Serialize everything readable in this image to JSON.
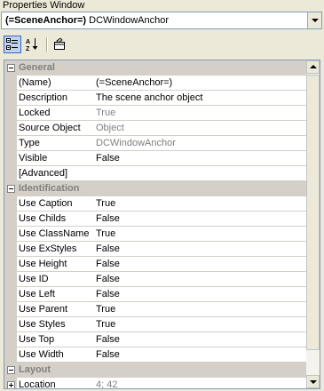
{
  "window": {
    "title": "Properties Window"
  },
  "object_selector": {
    "object_name": "(=SceneAnchor=)",
    "object_type": "DCWindowAnchor"
  },
  "toolbar": {
    "buttons": [
      {
        "icon": "categorized-icon",
        "pressed": true
      },
      {
        "icon": "alphabetical-sort-icon",
        "pressed": false
      },
      {
        "icon": "property-pages-icon",
        "pressed": false
      }
    ]
  },
  "grid": {
    "categories": {
      "general": {
        "label": "General"
      },
      "identification": {
        "label": "Identification"
      },
      "layout": {
        "label": "Layout"
      }
    },
    "rows": {
      "name": {
        "name": "(Name)",
        "value": "(=SceneAnchor=)"
      },
      "description": {
        "name": "Description",
        "value": "The scene anchor object"
      },
      "locked": {
        "name": "Locked",
        "value": "True"
      },
      "source_object": {
        "name": "Source Object",
        "value": "Object"
      },
      "type": {
        "name": "Type",
        "value": "DCWindowAnchor"
      },
      "visible": {
        "name": "Visible",
        "value": "False"
      },
      "advanced": {
        "name": "[Advanced]",
        "value": ""
      },
      "use_caption": {
        "name": "Use Caption",
        "value": "True"
      },
      "use_childs": {
        "name": "Use Childs",
        "value": "False"
      },
      "use_classname": {
        "name": "Use ClassName",
        "value": "True"
      },
      "use_exstyles": {
        "name": "Use ExStyles",
        "value": "False"
      },
      "use_height": {
        "name": "Use Height",
        "value": "False"
      },
      "use_id": {
        "name": "Use ID",
        "value": "False"
      },
      "use_left": {
        "name": "Use Left",
        "value": "False"
      },
      "use_parent": {
        "name": "Use Parent",
        "value": "True"
      },
      "use_styles": {
        "name": "Use Styles",
        "value": "True"
      },
      "use_top": {
        "name": "Use Top",
        "value": "False"
      },
      "use_width": {
        "name": "Use Width",
        "value": "False"
      },
      "location": {
        "name": "Location",
        "value": "4; 42"
      }
    }
  },
  "colors": {
    "category_bg": "#d4d0c8",
    "readonly_text": "#808080",
    "window_bg": "#ece9d8"
  }
}
